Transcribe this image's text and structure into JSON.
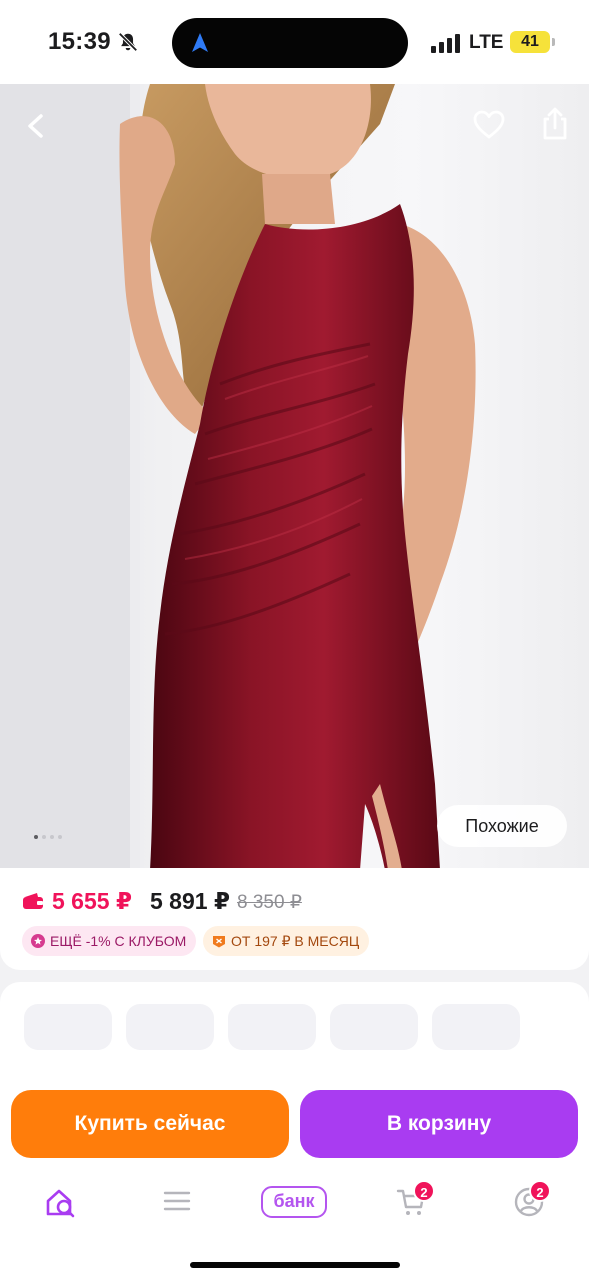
{
  "status_bar": {
    "time": "15:39",
    "network": "LTE",
    "battery": "41"
  },
  "product_photo": {
    "image_count": 4,
    "active_image_index": 0,
    "similar_label": "Похожие",
    "subject": "woman in a burgundy velvet sleeveless ruched midi dress with side slit"
  },
  "price": {
    "club_price": "5 655 ₽",
    "regular_price": "5 891 ₽",
    "old_price": "8 350 ₽",
    "club_badge": "ЕЩЁ -1% С КЛУБОМ",
    "installment_badge": "ОТ 197 ₽ В МЕСЯЦ"
  },
  "actions": {
    "buy_now": "Купить сейчас",
    "add_to_cart": "В корзину"
  },
  "tab_bar": {
    "bank_label": "банк",
    "cart_badge": "2",
    "profile_badge": "2"
  },
  "colors": {
    "club_price": "#f0135a",
    "buy_now": "#ff7d0b",
    "add_to_cart": "#a93cf1",
    "bank": "#b455ef",
    "dress": "#7a0f20"
  }
}
